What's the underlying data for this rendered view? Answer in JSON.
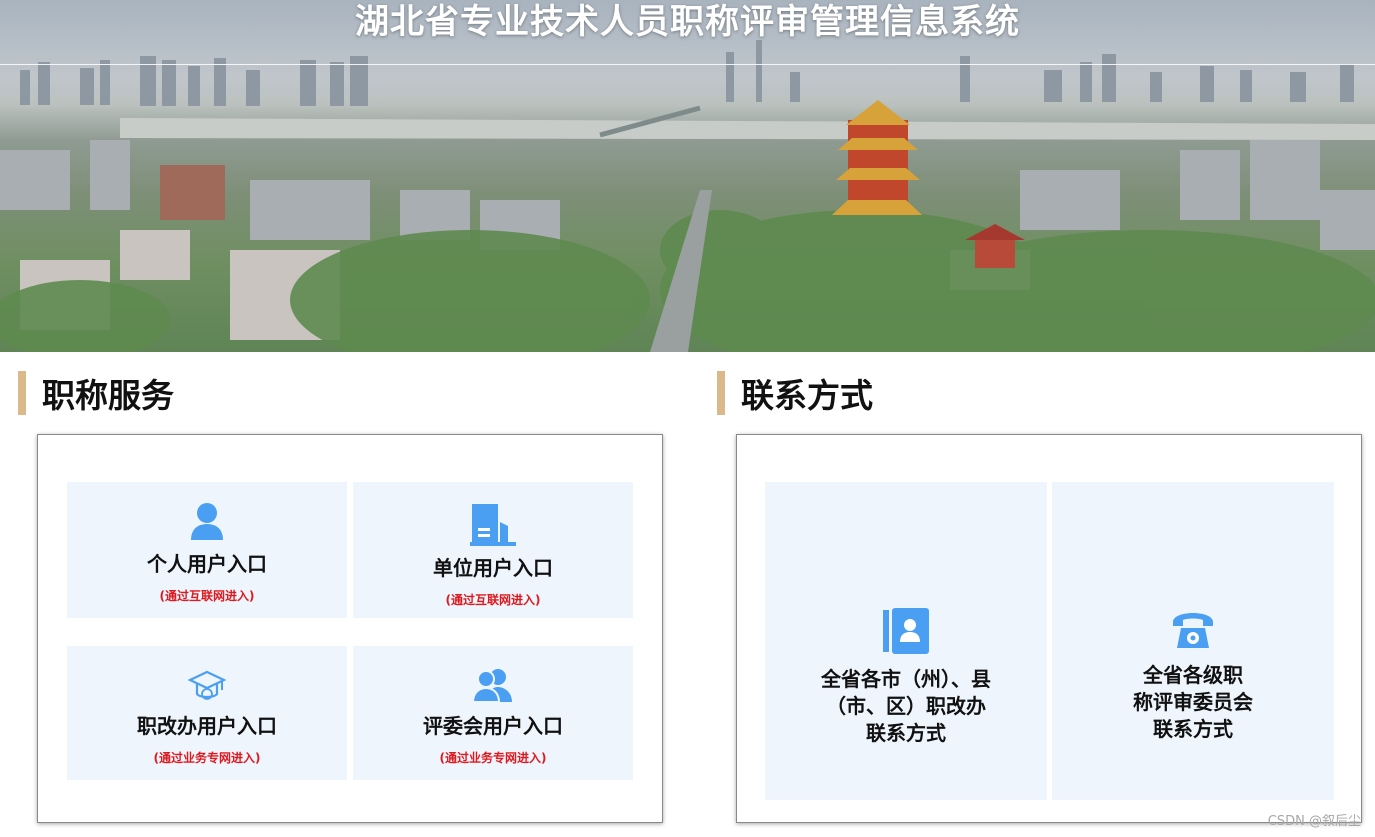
{
  "header": {
    "title": "湖北省专业技术人员职称评审管理信息系统"
  },
  "services": {
    "title": "职称服务",
    "tiles": [
      {
        "label": "个人用户入口",
        "note": "(通过互联网进入)",
        "icon": "person-icon"
      },
      {
        "label": "单位用户入口",
        "note": "(通过互联网进入)",
        "icon": "building-icon"
      },
      {
        "label": "职改办用户入口",
        "note": "(通过业务专网进入)",
        "icon": "graduation-cap-icon"
      },
      {
        "label": "评委会用户入口",
        "note": "(通过业务专网进入)",
        "icon": "users-icon"
      }
    ]
  },
  "contact": {
    "title": "联系方式",
    "tiles": [
      {
        "line1": "全省各市（州）、县",
        "line2": "（市、区）职改办",
        "line3": "联系方式",
        "icon": "address-book-icon"
      },
      {
        "line1": "全省各级职",
        "line2": "称评审委员会",
        "line3": "联系方式",
        "icon": "telephone-icon"
      }
    ]
  },
  "watermark": "CSDN @叙后尘",
  "colors": {
    "accent_bar": "#dcb98a",
    "icon_blue": "#4b9ff2",
    "tile_bg": "#eef5fd",
    "note_red": "#e0191e"
  }
}
